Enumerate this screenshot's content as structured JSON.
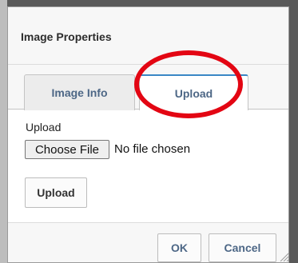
{
  "dialog": {
    "title": "Image Properties"
  },
  "tabs": [
    {
      "label": "Image Info",
      "selected": false
    },
    {
      "label": "Upload",
      "selected": true
    }
  ],
  "upload": {
    "field_label": "Upload",
    "choose_file_label": "Choose File",
    "file_status": "No file chosen",
    "upload_button_label": "Upload"
  },
  "footer": {
    "ok_label": "OK",
    "cancel_label": "Cancel"
  },
  "colors": {
    "tab_text": "#4d6786",
    "active_tab_border": "#3a87c5",
    "highlight": "#e30613"
  },
  "icons": [
    "resize-grip-icon"
  ]
}
